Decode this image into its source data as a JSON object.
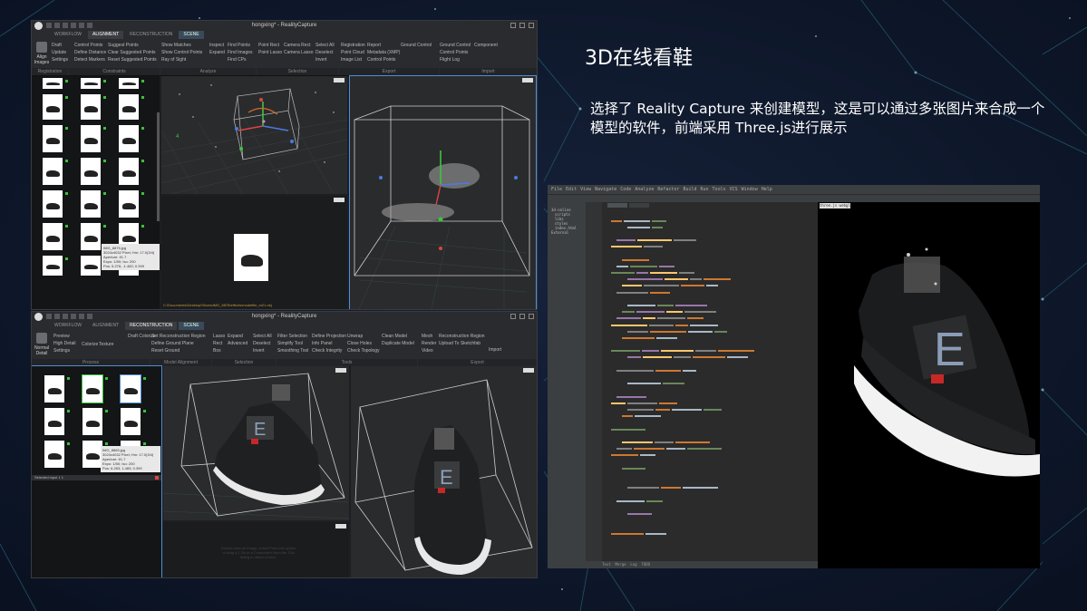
{
  "slide": {
    "heading": "3D在线看鞋",
    "description": "选择了 Reality Capture 来创建模型，这是可以通过多张图片来合成一个模型的软件，前端采用 Three.js进行展示"
  },
  "window1": {
    "title": "hongxing* - RealityCapture",
    "tabs": [
      "WORKFLOW",
      "ALIGNMENT",
      "RECONSTRUCTION",
      "SCENE"
    ],
    "active_tab": "ALIGNMENT",
    "big_button": "Align Images",
    "ribbon": {
      "col1": [
        "Draft",
        "Update",
        "Settings"
      ],
      "col2": [
        "Control Points",
        "Define Distance",
        "Detect Markers"
      ],
      "col3": [
        "Suggest Points",
        "Clear Suggested Points",
        "Reset Suggested Points"
      ],
      "col4": [
        "Show Matches",
        "Show Control Points",
        "Ray of Sight"
      ],
      "col5": [
        "Inspect",
        "Expand"
      ],
      "col6": [
        "Find Points",
        "Find Images",
        "Find CPs"
      ],
      "col7": [
        "Point Rect",
        "Point Lasso"
      ],
      "col8": [
        "Camera Rect",
        "Camera Lasso"
      ],
      "col9": [
        "Select All",
        "Deselect",
        "Invert"
      ],
      "col10": [
        "Registration",
        "Point Cloud",
        "Image List"
      ],
      "col11": [
        "Report",
        "Metadata (XMP)",
        "Control Points"
      ],
      "col12": [
        "Ground Control"
      ],
      "col13": [
        "Ground Control",
        "Control Points",
        "Flight Log"
      ],
      "col14": [
        "Component"
      ]
    },
    "ribbon_groups": [
      "Registration",
      "Constraints",
      "Analyze",
      "Selection",
      "Export",
      "Import"
    ],
    "tooltip": [
      "IMG_8875.jpg",
      "3024x4032 Pixel; Hm: 17.0(3/4)",
      "Aperture: f/1.7",
      "Expo: 1/50; Iso: 200",
      "Pos: 5.276; -1.482; 0.399"
    ],
    "status_path": "C:\\Documents\\Desktop\\Shoes\\IMG_8878\\effects\\modelfile_m21.obj"
  },
  "window2": {
    "title": "hongxing* - RealityCapture",
    "tabs": [
      "WORKFLOW",
      "ALIGNMENT",
      "RECONSTRUCTION",
      "SCENE"
    ],
    "active_tab": "RECONSTRUCTION",
    "big_button": "Normal Detail",
    "ribbon": {
      "col1": [
        "Preview",
        "High Detail",
        "Settings"
      ],
      "col2": [
        "Colorize",
        "Texture"
      ],
      "col3": [
        "Draft Colorize"
      ],
      "col4": [
        "Set Reconstruction Region",
        "Define Ground Plane",
        "Reset Ground"
      ],
      "col5": [
        "Lasso",
        "Rect",
        "Box"
      ],
      "col6": [
        "Expand",
        "Advanced"
      ],
      "col7": [
        "Select All",
        "Deselect",
        "Invert"
      ],
      "col8": [
        "Filter Selection",
        "Simplify Tool",
        "Smoothing Tool"
      ],
      "col9": [
        "Define Projection",
        "Info Panel",
        "Check Integrity"
      ],
      "col10": [
        "Unwrap",
        "Close Holes",
        "Check Topology"
      ],
      "col11": [
        "Clean Model",
        "Duplicate Model"
      ],
      "col12": [
        "Mesh",
        "Render",
        "Video"
      ],
      "col13": [
        "Reconstruction Region",
        "Upload To Sketchfab"
      ],
      "col14": [
        "Import"
      ]
    },
    "ribbon_groups": [
      "Process",
      "Model Alignment",
      "Selection",
      "Tools",
      "Export"
    ],
    "tooltip": [
      "IMG_8865.jpg",
      "3024x4032 Pixel; Hm: 17.0(3/4)",
      "Aperture: f/1.7",
      "Expo: 1/50; Iso: 200",
      "Pos: 6.283; 1.483; 0.399"
    ],
    "selection_label": "Selected input 1 1",
    "viewport_hint": [
      "Double-click an image, select Point Info option",
      "or drag a 1 Ds or a Component from the 1Ds",
      "listing to attach it here."
    ]
  },
  "ide": {
    "menu": [
      "File",
      "Edit",
      "View",
      "Navigate",
      "Code",
      "Analyze",
      "Refactor",
      "Build",
      "Run",
      "Tools",
      "VCS",
      "Window",
      "Help"
    ],
    "project_tree": [
      "3d-online",
      "scripts",
      "libs",
      "styles",
      "index.html",
      "External"
    ],
    "file_tab": "index.html",
    "render_tab": "three.js webgl",
    "status": [
      "Text",
      "Merge",
      "Log",
      "TODO"
    ]
  },
  "colors": {
    "background": "#0d1628",
    "accent_green": "#36c23a",
    "selection_blue": "#4d8fd6",
    "heading": "#ffffff"
  }
}
